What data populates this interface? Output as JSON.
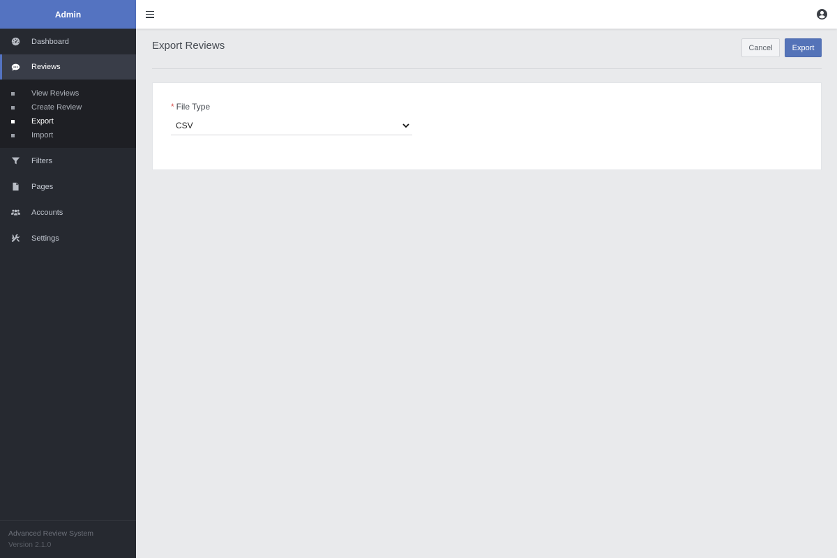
{
  "sidebar": {
    "brand": "Admin",
    "items": [
      {
        "label": "Dashboard",
        "icon": "dashboard-icon",
        "active": false
      },
      {
        "label": "Reviews",
        "icon": "comment-icon",
        "active": true
      },
      {
        "label": "Filters",
        "icon": "filter-icon",
        "active": false
      },
      {
        "label": "Pages",
        "icon": "file-icon",
        "active": false
      },
      {
        "label": "Accounts",
        "icon": "users-icon",
        "active": false
      },
      {
        "label": "Settings",
        "icon": "tools-icon",
        "active": false
      }
    ],
    "submenu": [
      {
        "label": "View Reviews",
        "active": false
      },
      {
        "label": "Create Review",
        "active": false
      },
      {
        "label": "Export",
        "active": true
      },
      {
        "label": "Import",
        "active": false
      }
    ],
    "footer": {
      "name": "Advanced Review System",
      "version": "Version 2.1.0"
    }
  },
  "topbar": {
    "menu_icon": "hamburger-icon",
    "user_icon": "user-circle-icon"
  },
  "page": {
    "title": "Export Reviews",
    "cancel_label": "Cancel",
    "export_label": "Export"
  },
  "form": {
    "file_type": {
      "required_mark": "*",
      "label": "File Type",
      "value": "CSV"
    }
  },
  "colors": {
    "accent": "#5473c1",
    "sidebar_bg": "#262930",
    "required": "#d9534f"
  }
}
